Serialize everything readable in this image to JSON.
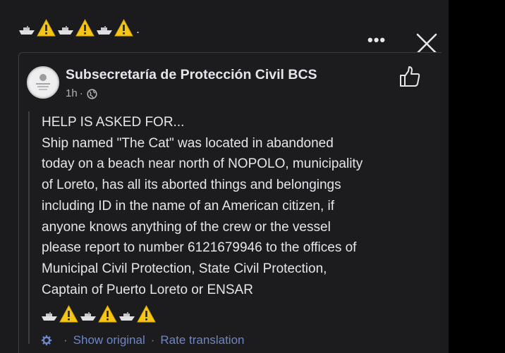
{
  "post": {
    "page_name": "Subsecretaría de Protección Civil BCS",
    "time": "1h",
    "meta_separator": "·",
    "body_lines": [
      "HELP IS ASKED FOR...",
      "Ship named \"The Cat\" was located in abandoned",
      "today on a beach near north of NOPOLO, municipality",
      "of Loreto, has all its aborted things and belongings",
      "including ID in the name of an American citizen, if",
      "anyone knows anything of the crew or the vessel",
      "please report to number 6121679946 to the offices of",
      "Municipal Civil Protection, State Civil Protection,",
      "Captain of Puerto Loreto or ENSAR"
    ]
  },
  "header": {
    "emoji_sequence": [
      "ship",
      "warning",
      "ship",
      "warning",
      "ship",
      "warning"
    ],
    "trailing_dot": ".",
    "more_label": "•••"
  },
  "footer_emoji": [
    "ship",
    "warning",
    "ship",
    "warning",
    "ship",
    "warning"
  ],
  "translation": {
    "show_original": "Show original",
    "separator": "·",
    "rate_translation": "Rate translation"
  },
  "icons": {
    "close": "close-icon",
    "like": "thumbs-up-icon",
    "globe": "globe-icon",
    "gear": "gear-icon",
    "ship": "ship-emoji-icon",
    "warning": "warning-emoji-icon"
  },
  "colors": {
    "background": "#1b1b1d",
    "text": "#e4e6eb",
    "secondary_text": "#b0b3b8",
    "link": "#6c86c9",
    "warning_yellow": "#f5c518"
  }
}
